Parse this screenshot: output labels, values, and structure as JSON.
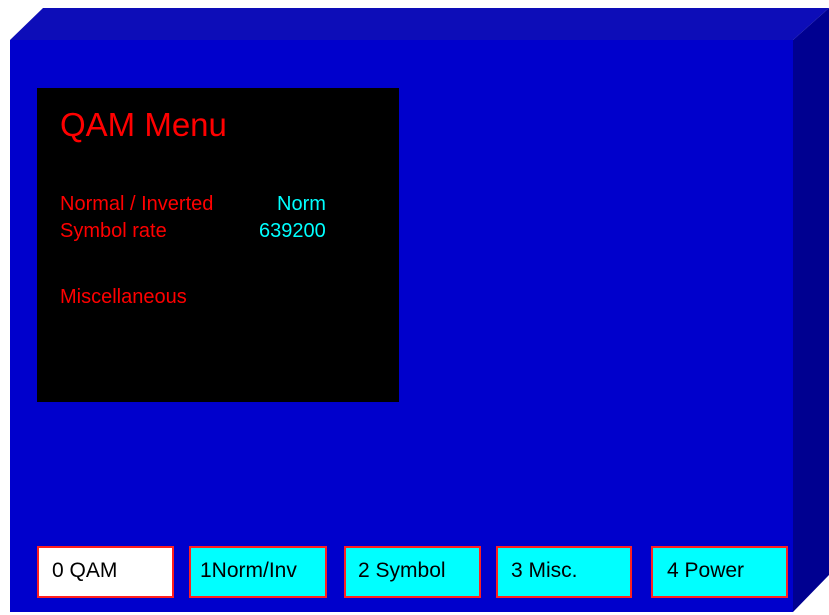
{
  "colors": {
    "panel_face": "#0000cc",
    "panel_top": "#0d0db8",
    "panel_side": "#000090",
    "screen_bg": "#000000",
    "label_color": "#ff0000",
    "value_color": "#00ffff",
    "softkey_bg": "#00ffff",
    "softkey_active_bg": "#ffffff",
    "softkey_border": "#ff2020"
  },
  "menu": {
    "title": "QAM Menu",
    "rows": [
      {
        "label": "Normal / Inverted",
        "value": "Norm"
      },
      {
        "label": "Symbol rate",
        "value": "639200"
      },
      {
        "label": "Miscellaneous",
        "value": ""
      }
    ]
  },
  "softkeys": [
    {
      "label": "0   QAM",
      "active": true
    },
    {
      "label": "1Norm/Inv",
      "active": false
    },
    {
      "label": "2 Symbol",
      "active": false
    },
    {
      "label": "3  Misc.",
      "active": false
    },
    {
      "label": "4 Power",
      "active": false
    }
  ]
}
